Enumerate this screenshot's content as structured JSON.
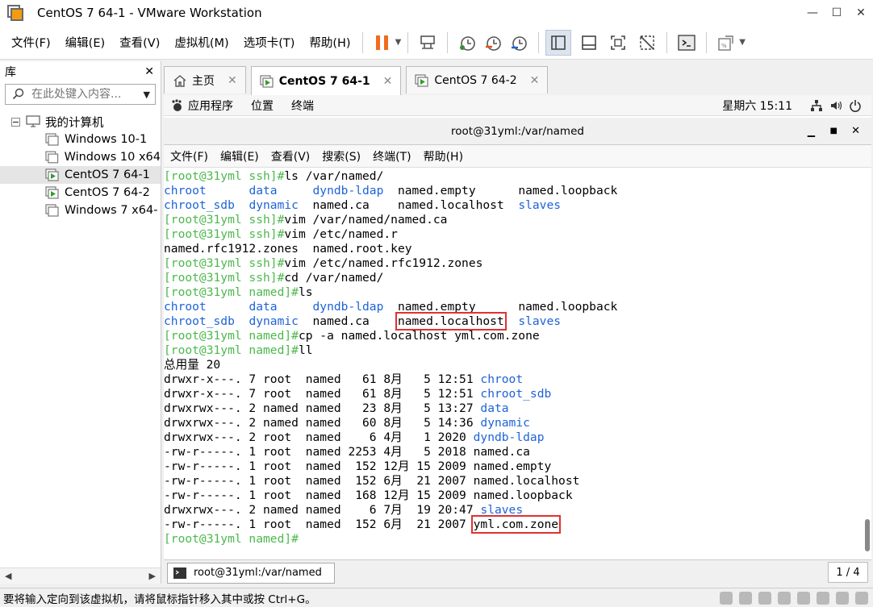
{
  "window": {
    "title": "CentOS 7 64-1 - VMware Workstation"
  },
  "menu": {
    "items": [
      "文件(F)",
      "编辑(E)",
      "查看(V)",
      "虚拟机(M)",
      "选项卡(T)",
      "帮助(H)"
    ]
  },
  "library": {
    "title": "库",
    "close": "✕",
    "search_placeholder": "在此处键入内容...",
    "root": "我的计算机",
    "vms": [
      "Windows 10-1",
      "Windows 10 x64",
      "CentOS 7 64-1",
      "CentOS 7 64-2",
      "Windows 7 x64-"
    ]
  },
  "tabs": [
    {
      "label": "主页"
    },
    {
      "label": "CentOS 7 64-1"
    },
    {
      "label": "CentOS 7 64-2"
    }
  ],
  "gnome": {
    "apps": "应用程序",
    "places": "位置",
    "terminal": "终端",
    "clock": "星期六 15:11"
  },
  "terminal": {
    "title": "root@31yml:/var/named",
    "menu": [
      "文件(F)",
      "编辑(E)",
      "查看(V)",
      "搜索(S)",
      "终端(T)",
      "帮助(H)"
    ],
    "task_label": "root@31yml:/var/named",
    "page": "1 / 4"
  },
  "lines": [
    {
      "p": "[root@31yml ssh]#",
      "t": "ls /var/named/"
    },
    {
      "s": [
        [
          "chroot      ",
          "b"
        ],
        [
          "data     ",
          "b"
        ],
        [
          "dyndb-ldap  ",
          "b"
        ],
        [
          "named.empty      named.loopback",
          ""
        ]
      ]
    },
    {
      "s": [
        [
          "chroot_sdb  ",
          "b"
        ],
        [
          "dynamic  ",
          "b"
        ],
        [
          "named.ca    named.localhost  ",
          ""
        ],
        [
          "slaves",
          "b"
        ]
      ]
    },
    {
      "p": "[root@31yml ssh]#",
      "t": "vim /var/named/named.ca"
    },
    {
      "p": "[root@31yml ssh]#",
      "t": "vim /etc/named.r"
    },
    {
      "s": [
        [
          "named.rfc1912.zones  named.root.key",
          ""
        ]
      ]
    },
    {
      "p": "[root@31yml ssh]#",
      "t": "vim /etc/named.rfc1912.zones"
    },
    {
      "p": "[root@31yml ssh]#",
      "t": "cd /var/named/"
    },
    {
      "p": "[root@31yml named]#",
      "t": "ls"
    },
    {
      "s": [
        [
          "chroot      ",
          "b"
        ],
        [
          "data     ",
          "b"
        ],
        [
          "dyndb-ldap  ",
          "b"
        ],
        [
          "named.empty      named.loopback",
          ""
        ]
      ]
    },
    {
      "s": [
        [
          "chroot_sdb  ",
          "b"
        ],
        [
          "dynamic  ",
          "b"
        ],
        [
          "named.ca    ",
          ""
        ],
        [
          "named.localhost",
          "box"
        ],
        [
          "  ",
          ""
        ],
        [
          "slaves",
          "b"
        ]
      ]
    },
    {
      "p": "[root@31yml named]#",
      "t": "cp -a named.localhost yml.com.zone"
    },
    {
      "p": "[root@31yml named]#",
      "t": "ll"
    },
    {
      "s": [
        [
          "总用量 20",
          ""
        ]
      ]
    },
    {
      "s": [
        [
          "drwxr-x---. 7 root  named   61 8月   5 12:51 ",
          ""
        ],
        [
          "chroot",
          "b"
        ]
      ]
    },
    {
      "s": [
        [
          "drwxr-x---. 7 root  named   61 8月   5 12:51 ",
          ""
        ],
        [
          "chroot_sdb",
          "b"
        ]
      ]
    },
    {
      "s": [
        [
          "drwxrwx---. 2 named named   23 8月   5 13:27 ",
          ""
        ],
        [
          "data",
          "b"
        ]
      ]
    },
    {
      "s": [
        [
          "drwxrwx---. 2 named named   60 8月   5 14:36 ",
          ""
        ],
        [
          "dynamic",
          "b"
        ]
      ]
    },
    {
      "s": [
        [
          "drwxrwx---. 2 root  named    6 4月   1 2020 ",
          ""
        ],
        [
          "dyndb-ldap",
          "b"
        ]
      ]
    },
    {
      "s": [
        [
          "-rw-r-----. 1 root  named 2253 4月   5 2018 named.ca",
          ""
        ]
      ]
    },
    {
      "s": [
        [
          "-rw-r-----. 1 root  named  152 12月 15 2009 named.empty",
          ""
        ]
      ]
    },
    {
      "s": [
        [
          "-rw-r-----. 1 root  named  152 6月  21 2007 named.localhost",
          ""
        ]
      ]
    },
    {
      "s": [
        [
          "-rw-r-----. 1 root  named  168 12月 15 2009 named.loopback",
          ""
        ]
      ]
    },
    {
      "s": [
        [
          "drwxrwx---. 2 named named    6 7月  19 20:47 ",
          ""
        ],
        [
          "slaves",
          "b"
        ]
      ]
    },
    {
      "s": [
        [
          "-rw-r-----. 1 root  named  152 6月  21 2007 ",
          ""
        ],
        [
          "yml.com.zone",
          "box"
        ]
      ]
    },
    {
      "p": "[root@31yml named]#",
      "t": ""
    }
  ],
  "status": {
    "text": "要将输入定向到该虚拟机，请将鼠标指针移入其中或按 Ctrl+G。"
  },
  "colors": {
    "prompt": "#4cb84c",
    "dir": "#1d63d8",
    "highlight": "#e03131",
    "play": "#2e9e2e"
  }
}
